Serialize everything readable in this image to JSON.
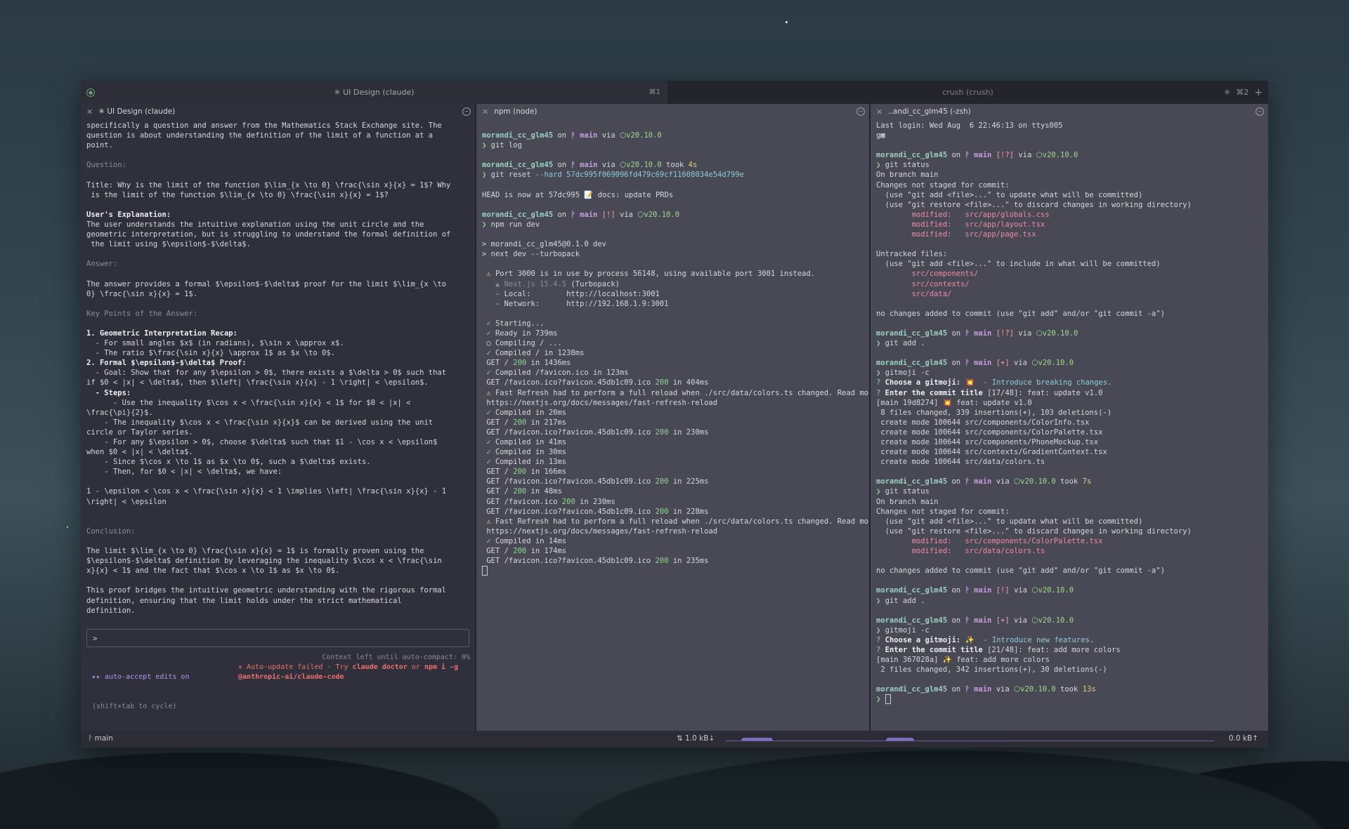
{
  "window": {
    "tab_active": "✳ UI Design (claude)",
    "tab_active_shortcut": "⌘1",
    "tab_inactive": "crush (crush)",
    "tab_inactive_shortcut": "⌘2",
    "tab_add": "+"
  },
  "left_pane": {
    "title": "✳ UI Design (claude)",
    "lines": [
      {
        "t": "specifically a question and answer from the Mathematics Stack Exchange site. The"
      },
      {
        "t": "question is about understanding the definition of the limit of a function at a"
      },
      {
        "t": "point."
      },
      {
        "t": ""
      },
      {
        "t": "Question:",
        "c": "dim"
      },
      {
        "t": ""
      },
      {
        "t": "Title: Why is the limit of the function $\\lim_{x \\to 0} \\frac{\\sin x}{x} = 1$? Why"
      },
      {
        "t": " is the limit of the function $\\lim_{x \\to 0} \\frac{\\sin x}{x} = 1$?"
      },
      {
        "t": ""
      },
      {
        "t": "User's Explanation:",
        "c": "bold"
      },
      {
        "t": "The user understands the intuitive explanation using the unit circle and the"
      },
      {
        "t": "geometric interpretation, but is struggling to understand the formal definition of"
      },
      {
        "t": " the limit using $\\epsilon$-$\\delta$."
      },
      {
        "t": ""
      },
      {
        "t": "Answer:",
        "c": "dim"
      },
      {
        "t": ""
      },
      {
        "t": "The answer provides a formal $\\epsilon$-$\\delta$ proof for the limit $\\lim_{x \\to"
      },
      {
        "t": "0} \\frac{\\sin x}{x} = 1$."
      },
      {
        "t": ""
      },
      {
        "t": "Key Points of the Answer:",
        "c": "dim"
      },
      {
        "t": ""
      },
      {
        "t": "1. Geometric Interpretation Recap:",
        "c": "bold"
      },
      {
        "t": "  - For small angles $x$ (in radians), $\\sin x \\approx x$."
      },
      {
        "t": "  - The ratio $\\frac{\\sin x}{x} \\approx 1$ as $x \\to 0$."
      },
      {
        "t": "2. Formal $\\epsilon$-$\\delta$ Proof:",
        "c": "bold"
      },
      {
        "t": "  - Goal: Show that for any $\\epsilon > 0$, there exists a $\\delta > 0$ such that"
      },
      {
        "t": "if $0 < |x| < \\delta$, then $\\left| \\frac{\\sin x}{x} - 1 \\right| < \\epsilon$."
      },
      {
        "t": "  - Steps:",
        "c": "bold"
      },
      {
        "t": "      - Use the inequality $\\cos x < \\frac{\\sin x}{x} < 1$ for $0 < |x| <"
      },
      {
        "t": "\\frac{\\pi}{2}$."
      },
      {
        "t": "    - The inequality $\\cos x < \\frac{\\sin x}{x}$ can be derived using the unit"
      },
      {
        "t": "circle or Taylor series."
      },
      {
        "t": "    - For any $\\epsilon > 0$, choose $\\delta$ such that $1 - \\cos x < \\epsilon$"
      },
      {
        "t": "when $0 < |x| < \\delta$."
      },
      {
        "t": "    - Since $\\cos x \\to 1$ as $x \\to 0$, such a $\\delta$ exists."
      },
      {
        "t": "    - Then, for $0 < |x| < \\delta$, we have:"
      },
      {
        "t": ""
      },
      {
        "t": "1 - \\epsilon < \\cos x < \\frac{\\sin x}{x} < 1 \\implies \\left| \\frac{\\sin x}{x} - 1"
      },
      {
        "t": "\\right| < \\epsilon"
      },
      {
        "t": ""
      },
      {
        "t": ""
      },
      {
        "t": "Conclusion:",
        "c": "dim"
      },
      {
        "t": ""
      },
      {
        "t": "The limit $\\lim_{x \\to 0} \\frac{\\sin x}{x} = 1$ is formally proven using the"
      },
      {
        "t": "$\\epsilon$-$\\delta$ definition by leveraging the inequality $\\cos x < \\frac{\\sin"
      },
      {
        "t": "x}{x} < 1$ and the fact that $\\cos x \\to 1$ as $x \\to 0$."
      },
      {
        "t": ""
      },
      {
        "t": "This proof bridges the intuitive geometric understanding with the rigorous formal"
      },
      {
        "t": "definition, ensuring that the limit holds under the strict mathematical"
      },
      {
        "t": "definition."
      }
    ],
    "prompt": ">",
    "mode_line1": "▸▸ auto-accept edits on",
    "mode_line2": "(shift+tab to cycle)",
    "context_left": "Context left until auto-compact: 0%",
    "update_fail_prefix": "✕ Auto-update failed · Try ",
    "update_cmd1": "claude doctor",
    "update_or": " or ",
    "update_cmd2": "npm i -g",
    "update_pkg": "@anthropic-ai/claude-code"
  },
  "mid_pane": {
    "title": "npm (node)",
    "lines": [
      [],
      [
        {
          "t": "morandi_cc_glm45",
          "c": "user"
        },
        {
          "t": " on "
        },
        {
          "t": "ᚹ main",
          "c": "branch"
        },
        {
          "t": " via "
        },
        {
          "t": "⬡v20.10.0",
          "c": "node"
        }
      ],
      [
        {
          "t": "❯ ",
          "c": "green"
        },
        {
          "t": "git log"
        }
      ],
      [],
      [
        {
          "t": "morandi_cc_glm45",
          "c": "user"
        },
        {
          "t": " on "
        },
        {
          "t": "ᚹ main",
          "c": "branch"
        },
        {
          "t": " via "
        },
        {
          "t": "⬡v20.10.0",
          "c": "node"
        },
        {
          "t": " took "
        },
        {
          "t": "4s",
          "c": "yellow"
        }
      ],
      [
        {
          "t": "❯ ",
          "c": "green"
        },
        {
          "t": "git reset "
        },
        {
          "t": "--hard 57dc995f069096fd479c69cf11608034e54d799e",
          "c": "cyan"
        }
      ],
      [],
      [
        {
          "t": "HEAD is now at 57dc995 📝 docs: update PRDs"
        }
      ],
      [],
      [
        {
          "t": "morandi_cc_glm45",
          "c": "user"
        },
        {
          "t": " on "
        },
        {
          "t": "ᚹ main",
          "c": "branch"
        },
        {
          "t": " [!]",
          "c": "red"
        },
        {
          "t": " via "
        },
        {
          "t": "⬡v20.10.0",
          "c": "node"
        }
      ],
      [
        {
          "t": "❯ ",
          "c": "green"
        },
        {
          "t": "npm run dev"
        }
      ],
      [],
      [
        {
          "t": "> morandi_cc_glm45@0.1.0 dev"
        }
      ],
      [
        {
          "t": "> next dev --turbopack"
        }
      ],
      [],
      [
        {
          "t": " ⚠ ",
          "c": "yellow"
        },
        {
          "t": "Port 3000 is in use by process 56148, using available port 3001 instead."
        }
      ],
      [
        {
          "t": "   ▲ Next.js 15.4.5",
          "c": "dim"
        },
        {
          "t": " (Turbopack)"
        }
      ],
      [
        {
          "t": "   - Local:        http://localhost:3001"
        }
      ],
      [
        {
          "t": "   - Network:      http://192.168.1.9:3001"
        }
      ],
      [],
      [
        {
          "t": " ✓ ",
          "c": "green"
        },
        {
          "t": "Starting..."
        }
      ],
      [
        {
          "t": " ✓ ",
          "c": "green"
        },
        {
          "t": "Ready in 739ms"
        }
      ],
      [
        {
          "t": " ○ "
        },
        {
          "t": "Compiling / ..."
        }
      ],
      [
        {
          "t": " ✓ ",
          "c": "green"
        },
        {
          "t": "Compiled / in 1238ms"
        }
      ],
      [
        {
          "t": " GET / "
        },
        {
          "t": "200",
          "c": "green"
        },
        {
          "t": " in 1436ms"
        }
      ],
      [
        {
          "t": " ✓ ",
          "c": "green"
        },
        {
          "t": "Compiled /favicon.ico in 123ms"
        }
      ],
      [
        {
          "t": " GET /favicon.ico?favicon.45db1c09.ico "
        },
        {
          "t": "200",
          "c": "green"
        },
        {
          "t": " in 404ms"
        }
      ],
      [
        {
          "t": " ⚠ ",
          "c": "yellow"
        },
        {
          "t": "Fast Refresh had to perform a full reload when ./src/data/colors.ts changed. Read more:"
        }
      ],
      [
        {
          "t": " https://nextjs.org/docs/messages/fast-refresh-reload"
        }
      ],
      [
        {
          "t": " ✓ ",
          "c": "green"
        },
        {
          "t": "Compiled in 20ms"
        }
      ],
      [
        {
          "t": " GET / "
        },
        {
          "t": "200",
          "c": "green"
        },
        {
          "t": " in 217ms"
        }
      ],
      [
        {
          "t": " GET /favicon.ico?favicon.45db1c09.ico "
        },
        {
          "t": "200",
          "c": "green"
        },
        {
          "t": " in 230ms"
        }
      ],
      [
        {
          "t": " ✓ ",
          "c": "green"
        },
        {
          "t": "Compiled in 41ms"
        }
      ],
      [
        {
          "t": " ✓ ",
          "c": "green"
        },
        {
          "t": "Compiled in 30ms"
        }
      ],
      [
        {
          "t": " ✓ ",
          "c": "green"
        },
        {
          "t": "Compiled in 13ms"
        }
      ],
      [
        {
          "t": " GET / "
        },
        {
          "t": "200",
          "c": "green"
        },
        {
          "t": " in 166ms"
        }
      ],
      [
        {
          "t": " GET /favicon.ico?favicon.45db1c09.ico "
        },
        {
          "t": "200",
          "c": "green"
        },
        {
          "t": " in 225ms"
        }
      ],
      [
        {
          "t": " GET / "
        },
        {
          "t": "200",
          "c": "green"
        },
        {
          "t": " in 48ms"
        }
      ],
      [
        {
          "t": " GET /favicon.ico "
        },
        {
          "t": "200",
          "c": "green"
        },
        {
          "t": " in 230ms"
        }
      ],
      [
        {
          "t": " GET /favicon.ico?favicon.45db1c09.ico "
        },
        {
          "t": "200",
          "c": "green"
        },
        {
          "t": " in 228ms"
        }
      ],
      [
        {
          "t": " ⚠ ",
          "c": "yellow"
        },
        {
          "t": "Fast Refresh had to perform a full reload when ./src/data/colors.ts changed. Read more:"
        }
      ],
      [
        {
          "t": " https://nextjs.org/docs/messages/fast-refresh-reload"
        }
      ],
      [
        {
          "t": " ✓ ",
          "c": "green"
        },
        {
          "t": "Compiled in 14ms"
        }
      ],
      [
        {
          "t": " GET / "
        },
        {
          "t": "200",
          "c": "green"
        },
        {
          "t": " in 174ms"
        }
      ],
      [
        {
          "t": " GET /favicon.ico?favicon.45db1c09.ico "
        },
        {
          "t": "200",
          "c": "green"
        },
        {
          "t": " in 235ms"
        }
      ]
    ]
  },
  "right_pane": {
    "title": "..andi_cc_glm45 (-zsh)",
    "lines": [
      [
        {
          "t": "Last login: Wed Aug  6 22:46:13 on ttys005"
        }
      ],
      [
        {
          "t": "g▦"
        }
      ],
      [],
      [
        {
          "t": "morandi_cc_glm45",
          "c": "user"
        },
        {
          "t": " on "
        },
        {
          "t": "ᚹ main",
          "c": "branch"
        },
        {
          "t": " [!?]",
          "c": "red"
        },
        {
          "t": " via "
        },
        {
          "t": "⬡v20.10.0",
          "c": "node"
        }
      ],
      [
        {
          "t": "❯ ",
          "c": "green"
        },
        {
          "t": "git status"
        }
      ],
      [
        {
          "t": "On branch main"
        }
      ],
      [
        {
          "t": "Changes not staged for commit:"
        }
      ],
      [
        {
          "t": "  (use \"git add <file>...\" to update what will be committed)"
        }
      ],
      [
        {
          "t": "  (use \"git restore <file>...\" to discard changes in working directory)"
        }
      ],
      [
        {
          "t": "        modified:   src/app/globals.css",
          "c": "pink"
        }
      ],
      [
        {
          "t": "        modified:   src/app/layout.tsx",
          "c": "pink"
        }
      ],
      [
        {
          "t": "        modified:   src/app/page.tsx",
          "c": "pink"
        }
      ],
      [],
      [
        {
          "t": "Untracked files:"
        }
      ],
      [
        {
          "t": "  (use \"git add <file>...\" to include in what will be committed)"
        }
      ],
      [
        {
          "t": "        src/components/",
          "c": "pink"
        }
      ],
      [
        {
          "t": "        src/contexts/",
          "c": "pink"
        }
      ],
      [
        {
          "t": "        src/data/",
          "c": "pink"
        }
      ],
      [],
      [
        {
          "t": "no changes added to commit (use \"git add\" and/or \"git commit -a\")"
        }
      ],
      [],
      [
        {
          "t": "morandi_cc_glm45",
          "c": "user"
        },
        {
          "t": " on "
        },
        {
          "t": "ᚹ main",
          "c": "branch"
        },
        {
          "t": " [!?]",
          "c": "red"
        },
        {
          "t": " via "
        },
        {
          "t": "⬡v20.10.0",
          "c": "node"
        }
      ],
      [
        {
          "t": "❯ ",
          "c": "green"
        },
        {
          "t": "git add ."
        }
      ],
      [],
      [
        {
          "t": "morandi_cc_glm45",
          "c": "user"
        },
        {
          "t": " on "
        },
        {
          "t": "ᚹ main",
          "c": "branch"
        },
        {
          "t": " [+]",
          "c": "red"
        },
        {
          "t": " via "
        },
        {
          "t": "⬡v20.10.0",
          "c": "node"
        }
      ],
      [
        {
          "t": "❯ ",
          "c": "green"
        },
        {
          "t": "gitmoji -c"
        }
      ],
      [
        {
          "t": "? ",
          "c": "green"
        },
        {
          "t": "Choose a gitmoji: ",
          "c": "bold"
        },
        {
          "t": "💥  - Introduce breaking changes.",
          "c": "cyan"
        }
      ],
      [
        {
          "t": "? ",
          "c": "green"
        },
        {
          "t": "Enter the commit title ",
          "c": "bold"
        },
        {
          "t": "[17/48]: feat: update v1.0"
        }
      ],
      [
        {
          "t": "[main 19d8274] 💥 feat: update v1.0"
        }
      ],
      [
        {
          "t": " 8 files changed, 339 insertions(+), 103 deletions(-)"
        }
      ],
      [
        {
          "t": " create mode 100644 src/components/ColorInfo.tsx"
        }
      ],
      [
        {
          "t": " create mode 100644 src/components/ColorPalette.tsx"
        }
      ],
      [
        {
          "t": " create mode 100644 src/components/PhoneMockup.tsx"
        }
      ],
      [
        {
          "t": " create mode 100644 src/contexts/GradientContext.tsx"
        }
      ],
      [
        {
          "t": " create mode 100644 src/data/colors.ts"
        }
      ],
      [],
      [
        {
          "t": "morandi_cc_glm45",
          "c": "user"
        },
        {
          "t": " on "
        },
        {
          "t": "ᚹ main",
          "c": "branch"
        },
        {
          "t": " via "
        },
        {
          "t": "⬡v20.10.0",
          "c": "node"
        },
        {
          "t": " took "
        },
        {
          "t": "7s",
          "c": "yellow"
        }
      ],
      [
        {
          "t": "❯ ",
          "c": "green"
        },
        {
          "t": "git status"
        }
      ],
      [
        {
          "t": "On branch main"
        }
      ],
      [
        {
          "t": "Changes not staged for commit:"
        }
      ],
      [
        {
          "t": "  (use \"git add <file>...\" to update what will be committed)"
        }
      ],
      [
        {
          "t": "  (use \"git restore <file>...\" to discard changes in working directory)"
        }
      ],
      [
        {
          "t": "        modified:   src/components/ColorPalette.tsx",
          "c": "pink"
        }
      ],
      [
        {
          "t": "        modified:   src/data/colors.ts",
          "c": "pink"
        }
      ],
      [],
      [
        {
          "t": "no changes added to commit (use \"git add\" and/or \"git commit -a\")"
        }
      ],
      [],
      [
        {
          "t": "morandi_cc_glm45",
          "c": "user"
        },
        {
          "t": " on "
        },
        {
          "t": "ᚹ main",
          "c": "branch"
        },
        {
          "t": " [!]",
          "c": "red"
        },
        {
          "t": " via "
        },
        {
          "t": "⬡v20.10.0",
          "c": "node"
        }
      ],
      [
        {
          "t": "❯ ",
          "c": "green"
        },
        {
          "t": "git add ."
        }
      ],
      [],
      [
        {
          "t": "morandi_cc_glm45",
          "c": "user"
        },
        {
          "t": " on "
        },
        {
          "t": "ᚹ main",
          "c": "branch"
        },
        {
          "t": " [+]",
          "c": "red"
        },
        {
          "t": " via "
        },
        {
          "t": "⬡v20.10.0",
          "c": "node"
        }
      ],
      [
        {
          "t": "❯ ",
          "c": "green"
        },
        {
          "t": "gitmoji -c"
        }
      ],
      [
        {
          "t": "? ",
          "c": "green"
        },
        {
          "t": "Choose a gitmoji: ",
          "c": "bold"
        },
        {
          "t": "✨  - Introduce new features.",
          "c": "cyan"
        }
      ],
      [
        {
          "t": "? ",
          "c": "green"
        },
        {
          "t": "Enter the commit title ",
          "c": "bold"
        },
        {
          "t": "[21/48]: feat: add more colors"
        }
      ],
      [
        {
          "t": "[main 367028a] ✨ feat: add more colors"
        }
      ],
      [
        {
          "t": " 2 files changed, 342 insertions(+), 30 deletions(-)"
        }
      ],
      [],
      [
        {
          "t": "morandi_cc_glm45",
          "c": "user"
        },
        {
          "t": " on "
        },
        {
          "t": "ᚹ main",
          "c": "branch"
        },
        {
          "t": " via "
        },
        {
          "t": "⬡v20.10.0",
          "c": "node"
        },
        {
          "t": " took "
        },
        {
          "t": "13s",
          "c": "yellow"
        }
      ],
      [
        {
          "t": "❯ ",
          "c": "green"
        }
      ]
    ]
  },
  "statusbar": {
    "branch": "ᚹ main",
    "download": "⇅ 1.0 kB↓",
    "upload": "0.0 kB↑"
  }
}
